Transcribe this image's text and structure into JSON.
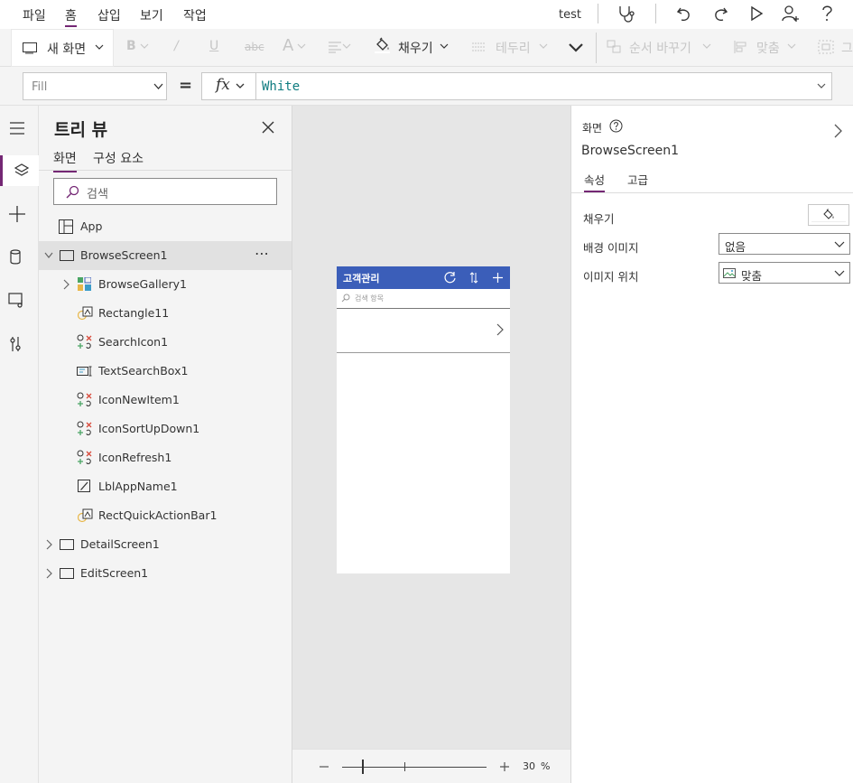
{
  "menu": {
    "items": [
      "파일",
      "홈",
      "삽입",
      "보기",
      "작업"
    ],
    "active_index": 1,
    "app_name": "test"
  },
  "toolbar": {
    "new_screen": "새 화면",
    "fill": "채우기",
    "border": "테두리",
    "reorder": "순서 바꾸기",
    "align": "맞춤",
    "group": "그"
  },
  "formula": {
    "property": "Fill",
    "equals": "=",
    "fx": "fx",
    "value": "White"
  },
  "tree": {
    "title": "트리 뷰",
    "tabs": [
      "화면",
      "구성 요소"
    ],
    "search_placeholder": "검색",
    "app_label": "App",
    "items": [
      {
        "label": "BrowseScreen1"
      },
      {
        "label": "BrowseGallery1"
      },
      {
        "label": "Rectangle11"
      },
      {
        "label": "SearchIcon1"
      },
      {
        "label": "TextSearchBox1"
      },
      {
        "label": "IconNewItem1"
      },
      {
        "label": "IconSortUpDown1"
      },
      {
        "label": "IconRefresh1"
      },
      {
        "label": "LblAppName1"
      },
      {
        "label": "RectQuickActionBar1"
      },
      {
        "label": "DetailScreen1"
      },
      {
        "label": "EditScreen1"
      }
    ]
  },
  "canvas": {
    "app_title": "고객관리",
    "search_placeholder": "검색 항목",
    "zoom": "30",
    "zoom_unit": "%",
    "zoom_fraction": 0.3
  },
  "properties": {
    "section": "화면",
    "screen_name": "BrowseScreen1",
    "tabs": [
      "속성",
      "고급"
    ],
    "fill_label": "채우기",
    "bg_image_label": "배경 이미지",
    "bg_image_value": "없음",
    "image_position_label": "이미지 위치",
    "image_position_value": "맞춤"
  },
  "colors": {
    "accent": "#742774",
    "phone_header": "#3b5eb9",
    "formula_text": "#0f7c80"
  }
}
